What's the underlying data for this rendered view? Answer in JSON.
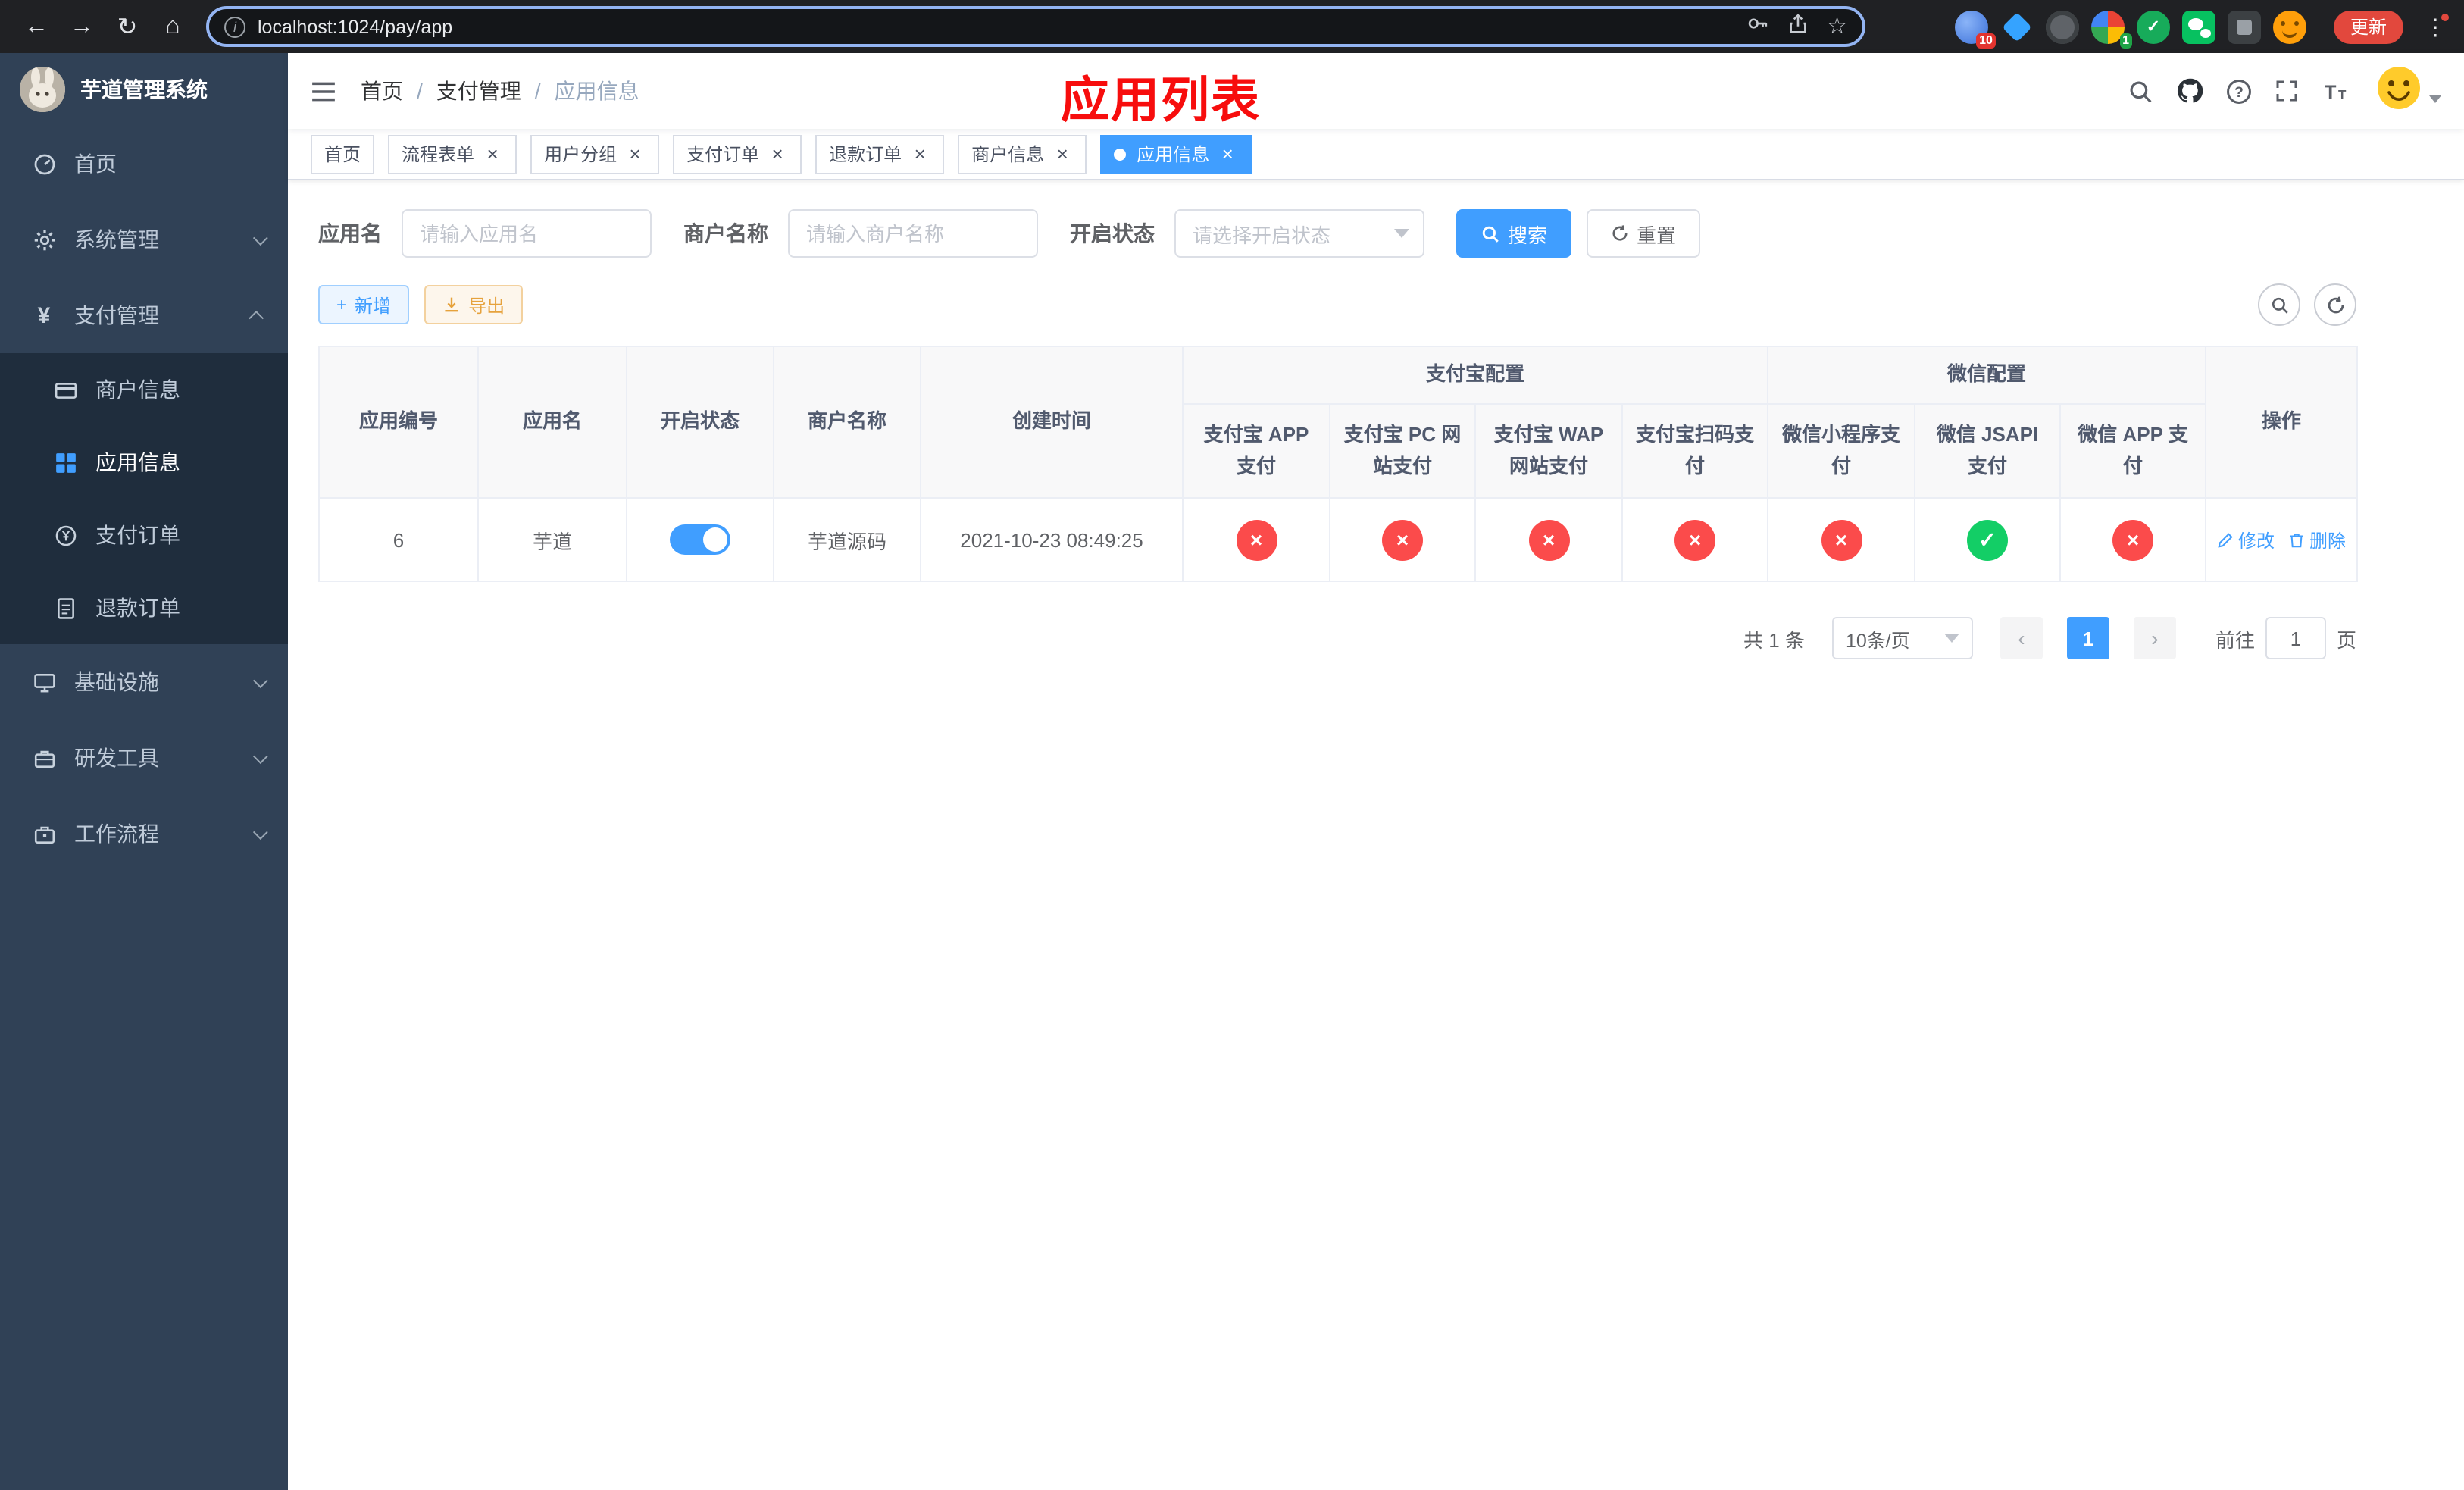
{
  "colors": {
    "accent": "#409eff",
    "danger": "#fb4b4b",
    "success": "#13ce66",
    "warning": "#e6a23c",
    "sidebar_bg": "#304156",
    "submenu_bg": "#1f2d3d",
    "annotation_red": "#f70d0d"
  },
  "icons": {
    "check": "✓",
    "cross": "×",
    "close": "×"
  },
  "browser": {
    "url": "localhost:1024/pay/app",
    "update_label": "更新",
    "badges": [
      "10",
      "1"
    ]
  },
  "sidebar": {
    "title": "芋道管理系统",
    "items": [
      {
        "label": "首页",
        "icon": "dashboard-icon"
      },
      {
        "label": "系统管理",
        "icon": "gear-icon"
      },
      {
        "label": "支付管理",
        "icon": "yen-icon",
        "children": [
          {
            "label": "商户信息",
            "icon": "credit-card-icon"
          },
          {
            "label": "应用信息",
            "icon": "grid-icon",
            "active": true
          },
          {
            "label": "支付订单",
            "icon": "order-icon"
          },
          {
            "label": "退款订单",
            "icon": "refund-doc-icon"
          }
        ]
      },
      {
        "label": "基础设施",
        "icon": "monitor-icon"
      },
      {
        "label": "研发工具",
        "icon": "toolbox-icon"
      },
      {
        "label": "工作流程",
        "icon": "briefcase-icon"
      }
    ]
  },
  "navbar": {
    "breadcrumb": [
      "首页",
      "支付管理",
      "应用信息"
    ],
    "annotation": "应用列表"
  },
  "tabs": [
    {
      "label": "首页",
      "closable": false,
      "active": false
    },
    {
      "label": "流程表单",
      "closable": true,
      "active": false
    },
    {
      "label": "用户分组",
      "closable": true,
      "active": false
    },
    {
      "label": "支付订单",
      "closable": true,
      "active": false
    },
    {
      "label": "退款订单",
      "closable": true,
      "active": false
    },
    {
      "label": "商户信息",
      "closable": true,
      "active": false
    },
    {
      "label": "应用信息",
      "closable": true,
      "active": true
    }
  ],
  "filters": {
    "app_name_label": "应用名",
    "app_name_placeholder": "请输入应用名",
    "merchant_label": "商户名称",
    "merchant_placeholder": "请输入商户名称",
    "status_label": "开启状态",
    "status_placeholder": "请选择开启状态",
    "search_label": "搜索",
    "reset_label": "重置"
  },
  "toolbar": {
    "add_label": "新增",
    "export_label": "导出"
  },
  "table": {
    "headers": {
      "app_id": "应用编号",
      "app_name": "应用名",
      "enabled": "开启状态",
      "merchant": "商户名称",
      "created": "创建时间",
      "alipay_group": "支付宝配置",
      "wechat_group": "微信配置",
      "actions": "操作",
      "channels": [
        "支付宝 APP 支付",
        "支付宝 PC 网站支付",
        "支付宝 WAP 网站支付",
        "支付宝扫码支付",
        "微信小程序支付",
        "微信 JSAPI 支付",
        "微信 APP 支付"
      ]
    },
    "rows": [
      {
        "app_id": "6",
        "app_name": "芋道",
        "enabled": true,
        "merchant": "芋道源码",
        "created": "2021-10-23 08:49:25",
        "channels": [
          false,
          false,
          false,
          false,
          false,
          true,
          false
        ],
        "edit_label": "修改",
        "delete_label": "删除"
      }
    ]
  },
  "pagination": {
    "total": "共 1 条",
    "page_size": "10条/页",
    "current_page": "1",
    "goto_prefix": "前往",
    "goto_value": "1",
    "goto_suffix": "页"
  }
}
